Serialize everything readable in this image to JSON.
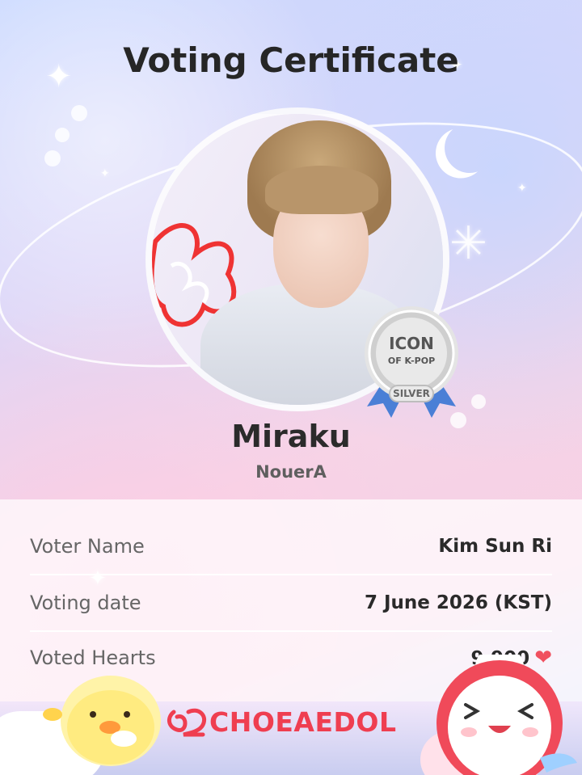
{
  "certificate": {
    "title": "Voting Certificate",
    "idol_name": "Miraku",
    "group_name": "NouerA"
  },
  "badge": {
    "line1": "ICON",
    "line2": "OF K-POP",
    "tier": "SILVER"
  },
  "details": {
    "voter_name_label": "Voter Name",
    "voter_name_value": "Kim Sun Ri",
    "voting_date_label": "Voting date",
    "voting_date_value": "7 June 2026 (KST)",
    "voted_hearts_label": "Voted Hearts",
    "voted_hearts_value": "9,900"
  },
  "brand": {
    "logo_text": "CHOEAEDOL"
  },
  "icons": {
    "heart": "heart-icon",
    "moon": "moon-icon",
    "sparkle": "sparkle-icon",
    "badge": "ribbon-badge-icon"
  },
  "colors": {
    "accent": "#ef3e50",
    "title": "#262626",
    "label": "#666666",
    "badge_ribbon": "#4a7fd6",
    "badge_silver": "#c9c9c9"
  }
}
